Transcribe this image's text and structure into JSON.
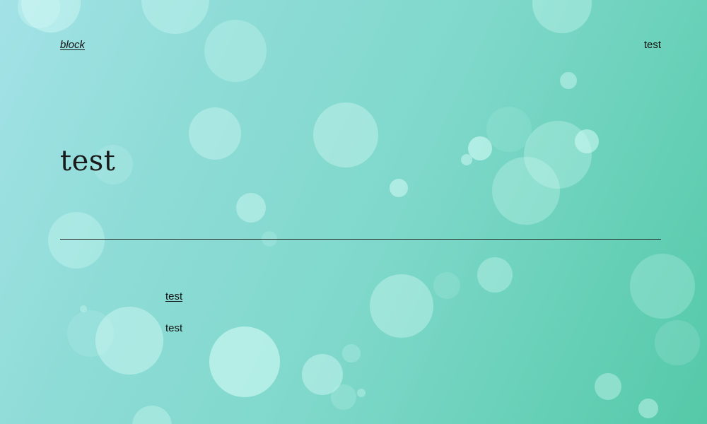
{
  "header": {
    "site_title": "block",
    "nav_link": "test"
  },
  "main": {
    "title": "test",
    "items": [
      {
        "label": "test",
        "is_link": true
      },
      {
        "label": "test",
        "is_link": false
      }
    ]
  },
  "theme": {
    "background_start": "#a3e2e7",
    "background_end": "#55c9a8",
    "text_color": "#111111",
    "decoration": "bokeh-circles"
  }
}
